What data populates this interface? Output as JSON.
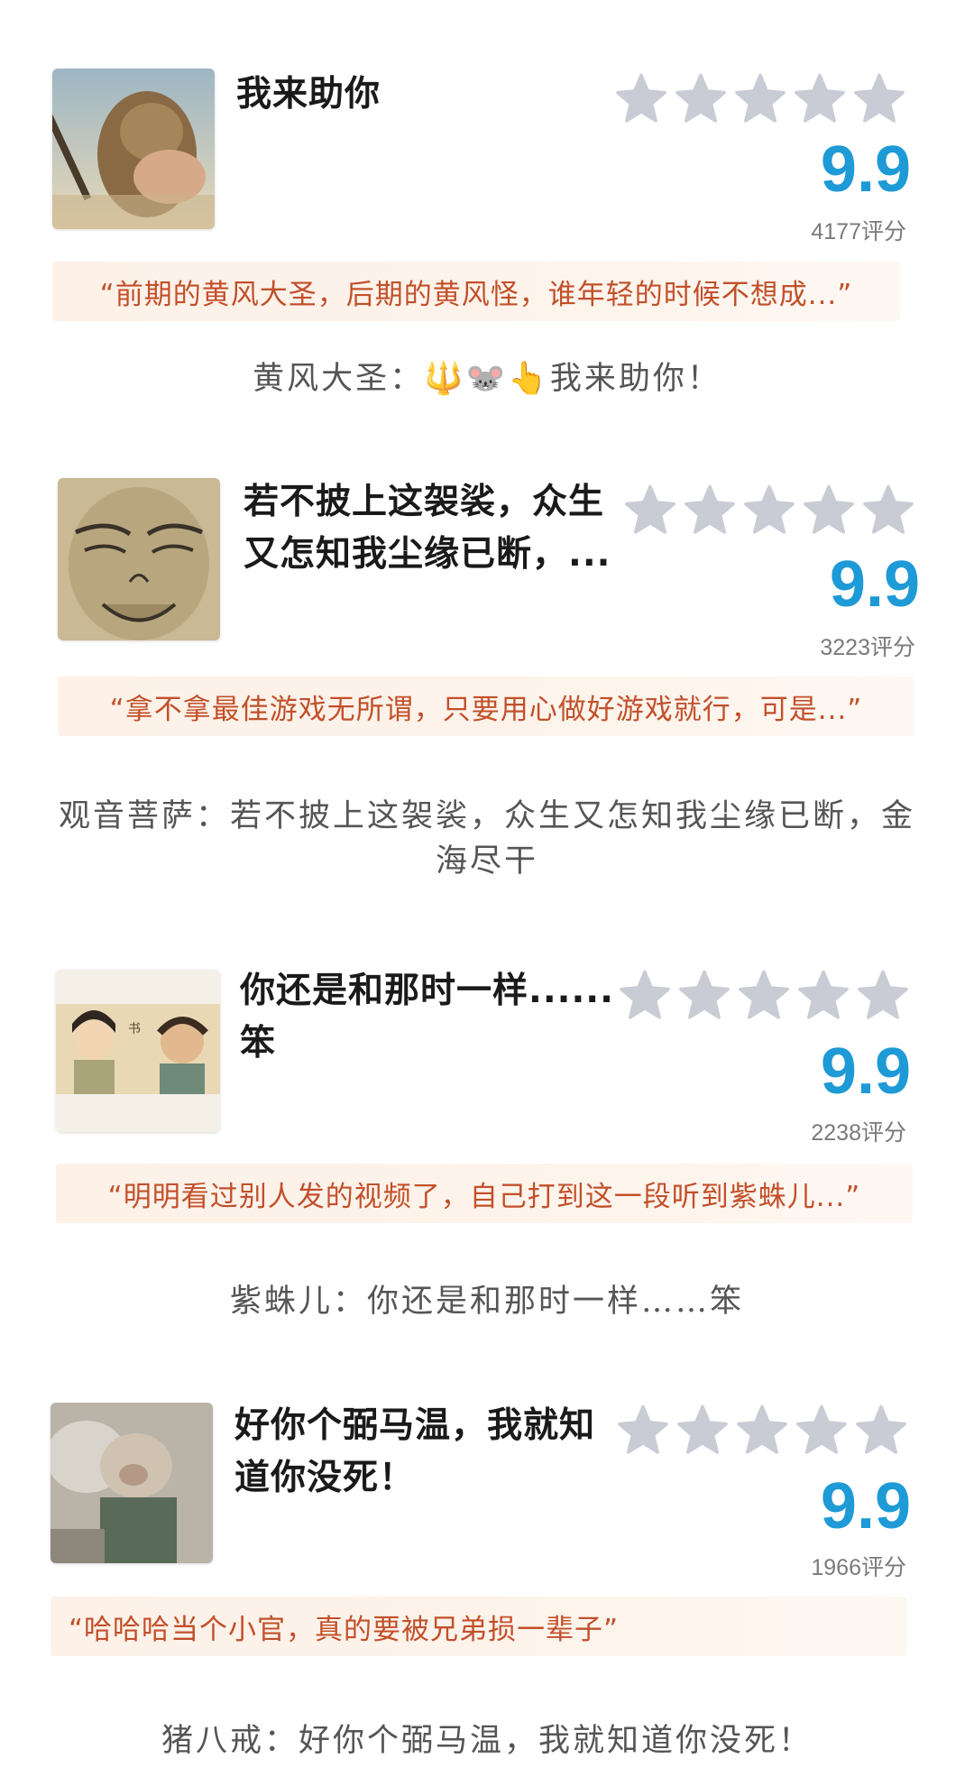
{
  "colors": {
    "accent_score": "#1e9ad6",
    "quote_text": "#c2502a",
    "quote_bg": "#fdf1e8",
    "star_gray": "#c9ccd4"
  },
  "cards": [
    {
      "title_lines": [
        "我来助你"
      ],
      "stars_filled": 0,
      "stars_total": 5,
      "score": "9.9",
      "count": "4177评分",
      "quote": "“前期的黄风大圣，后期的黄风怪，谁年轻的时候不想成...”",
      "caption": "黄风大圣：🔱🐭👆我来助你！",
      "thumb_icon": "yellow-wind-sage-thumbnail"
    },
    {
      "title_lines": [
        "若不披上这袈裟，众生",
        "又怎知我尘缘已断，..."
      ],
      "stars_filled": 0,
      "stars_total": 5,
      "score": "9.9",
      "count": "3223评分",
      "quote": "“拿不拿最佳游戏无所谓，只要用心做好游戏就行，可是...”",
      "caption": "观音菩萨：若不披上这袈裟，众生又怎知我尘缘已断，金海尽干",
      "thumb_icon": "guanyin-face-thumbnail"
    },
    {
      "title_lines": [
        "你还是和那时一样......",
        "笨"
      ],
      "stars_filled": 0,
      "stars_total": 5,
      "score": "9.9",
      "count": "2238评分",
      "quote": "“明明看过别人发的视频了，自己打到这一段听到紫蛛儿...”",
      "caption": "紫蛛儿：你还是和那时一样……笨",
      "thumb_icon": "couple-animation-thumbnail"
    },
    {
      "title_lines": [
        "好你个弼马温，我就知",
        "道你没死！"
      ],
      "stars_filled": 0,
      "stars_total": 5,
      "score": "9.9",
      "count": "1966评分",
      "quote": "“哈哈哈当个小官，真的要被兄弟损一辈子”",
      "caption": "猪八戒：好你个弼马温，我就知道你没死！",
      "thumb_icon": "zhu-bajie-thumbnail"
    }
  ]
}
